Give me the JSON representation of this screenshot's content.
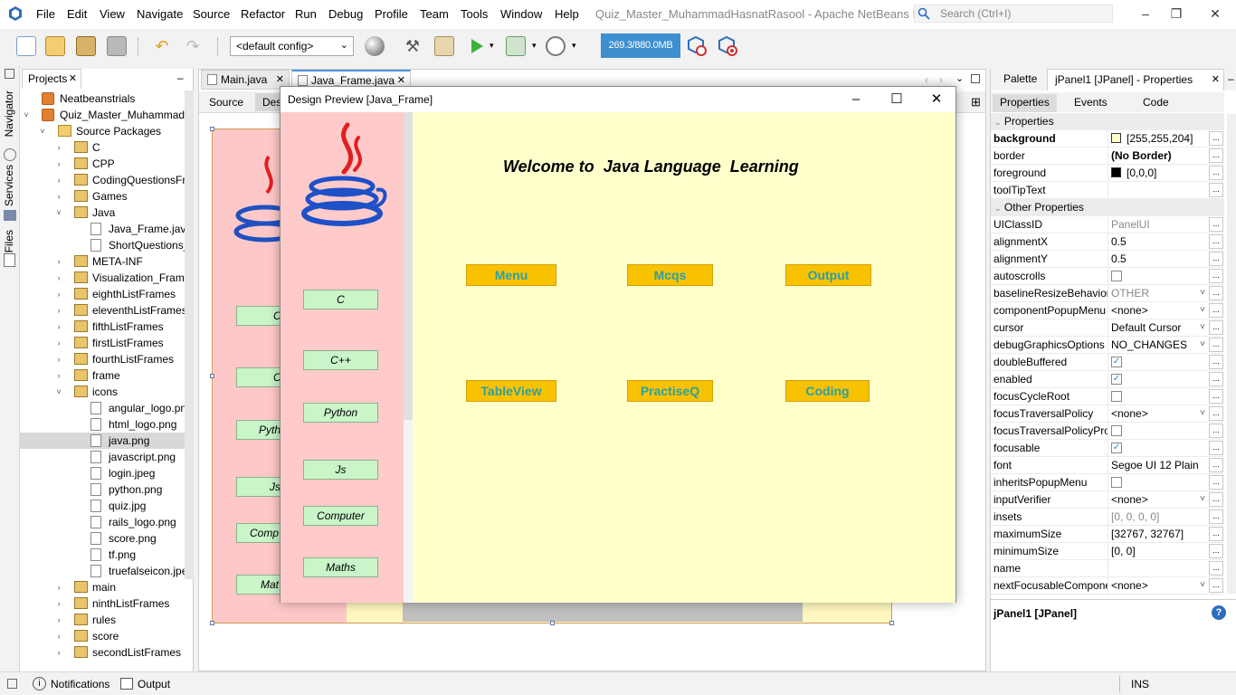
{
  "titlebar": {
    "menu": [
      "File",
      "Edit",
      "View",
      "Navigate",
      "Source",
      "Refactor",
      "Run",
      "Debug",
      "Profile",
      "Team",
      "Tools",
      "Window",
      "Help"
    ],
    "window_title": "Quiz_Master_MuhammadHasnatRasool - Apache NetBeans ID...",
    "search_placeholder": "Search (Ctrl+I)"
  },
  "toolbar": {
    "config": "<default config>",
    "memory": "269.3/880.0MB"
  },
  "left_strip": {
    "tabs": [
      "Navigator",
      "Services",
      "Files"
    ]
  },
  "projects": {
    "tab_label": "Projects",
    "rows": [
      {
        "label": "Neatbeanstrials",
        "depth": 0,
        "kind": "proj",
        "toggle": ""
      },
      {
        "label": "Quiz_Master_MuhammadHas",
        "depth": 0,
        "kind": "proj",
        "toggle": "v"
      },
      {
        "label": "Source Packages",
        "depth": 1,
        "kind": "folder",
        "toggle": "v"
      },
      {
        "label": "C",
        "depth": 2,
        "kind": "pkg",
        "toggle": ">"
      },
      {
        "label": "CPP",
        "depth": 2,
        "kind": "pkg",
        "toggle": ">"
      },
      {
        "label": "CodingQuestionsFrame",
        "depth": 2,
        "kind": "pkg",
        "toggle": ">"
      },
      {
        "label": "Games",
        "depth": 2,
        "kind": "pkg",
        "toggle": ">"
      },
      {
        "label": "Java",
        "depth": 2,
        "kind": "pkg",
        "toggle": "v"
      },
      {
        "label": "Java_Frame.java",
        "depth": 3,
        "kind": "file",
        "toggle": ""
      },
      {
        "label": "ShortQuestions_Fra",
        "depth": 3,
        "kind": "file",
        "toggle": ""
      },
      {
        "label": "META-INF",
        "depth": 2,
        "kind": "pkg",
        "toggle": ">"
      },
      {
        "label": "Visualization_Frames",
        "depth": 2,
        "kind": "pkg",
        "toggle": ">"
      },
      {
        "label": "eighthListFrames",
        "depth": 2,
        "kind": "pkg",
        "toggle": ">"
      },
      {
        "label": "eleventhListFrames",
        "depth": 2,
        "kind": "pkg",
        "toggle": ">"
      },
      {
        "label": "fifthListFrames",
        "depth": 2,
        "kind": "pkg",
        "toggle": ">"
      },
      {
        "label": "firstListFrames",
        "depth": 2,
        "kind": "pkg",
        "toggle": ">"
      },
      {
        "label": "fourthListFrames",
        "depth": 2,
        "kind": "pkg",
        "toggle": ">"
      },
      {
        "label": "frame",
        "depth": 2,
        "kind": "pkg",
        "toggle": ">"
      },
      {
        "label": "icons",
        "depth": 2,
        "kind": "pkg",
        "toggle": "v"
      },
      {
        "label": "angular_logo.png",
        "depth": 3,
        "kind": "file",
        "toggle": ""
      },
      {
        "label": "html_logo.png",
        "depth": 3,
        "kind": "file",
        "toggle": ""
      },
      {
        "label": "java.png",
        "depth": 3,
        "kind": "file",
        "toggle": "",
        "selected": true
      },
      {
        "label": "javascript.png",
        "depth": 3,
        "kind": "file",
        "toggle": ""
      },
      {
        "label": "login.jpeg",
        "depth": 3,
        "kind": "file",
        "toggle": ""
      },
      {
        "label": "python.png",
        "depth": 3,
        "kind": "file",
        "toggle": ""
      },
      {
        "label": "quiz.jpg",
        "depth": 3,
        "kind": "file",
        "toggle": ""
      },
      {
        "label": "rails_logo.png",
        "depth": 3,
        "kind": "file",
        "toggle": ""
      },
      {
        "label": "score.png",
        "depth": 3,
        "kind": "file",
        "toggle": ""
      },
      {
        "label": "tf.png",
        "depth": 3,
        "kind": "file",
        "toggle": ""
      },
      {
        "label": "truefalseicon.jpeg",
        "depth": 3,
        "kind": "file",
        "toggle": ""
      },
      {
        "label": "main",
        "depth": 2,
        "kind": "pkg",
        "toggle": ">"
      },
      {
        "label": "ninthListFrames",
        "depth": 2,
        "kind": "pkg",
        "toggle": ">"
      },
      {
        "label": "rules",
        "depth": 2,
        "kind": "pkg",
        "toggle": ">"
      },
      {
        "label": "score",
        "depth": 2,
        "kind": "pkg",
        "toggle": ">"
      },
      {
        "label": "secondListFrames",
        "depth": 2,
        "kind": "pkg",
        "toggle": ">"
      }
    ]
  },
  "editor": {
    "tabs": [
      "Main.java",
      "Java_Frame.java"
    ],
    "sub_tabs": [
      "Source",
      "Des"
    ],
    "canvas_buttons": [
      "C",
      "C+",
      "Pyth",
      "Js",
      "Comp",
      "Mat"
    ]
  },
  "preview": {
    "title": "Design Preview [Java_Frame]",
    "welcome": "Welcome to  Java Language  Learning",
    "left_buttons": [
      "C",
      "C++",
      "Python",
      "Js",
      "Computer",
      "Maths"
    ],
    "action_buttons": [
      "Menu",
      "Mcqs",
      "Output",
      "TableView",
      "PractiseQ",
      "Coding"
    ],
    "colors": {
      "left_panel": "#ffcaca",
      "main_panel": "#ffffcc",
      "button": "#f8c200",
      "button_text": "#2ba0a8"
    }
  },
  "properties": {
    "palette_tab": "Palette",
    "props_tab": "jPanel1 [JPanel] - Properties",
    "sub_tabs": [
      "Properties",
      "Events",
      "Code"
    ],
    "section_main": "Properties",
    "main_rows": [
      {
        "name": "background",
        "value": "[255,255,204]",
        "bold": true,
        "swatch": "#ffffcc"
      },
      {
        "name": "border",
        "value": "(No Border)",
        "bold": false,
        "value_bold": true
      },
      {
        "name": "foreground",
        "value": "[0,0,0]",
        "swatch": "#000000"
      },
      {
        "name": "toolTipText",
        "value": ""
      }
    ],
    "section_other": "Other Properties",
    "other_rows": [
      {
        "name": "UIClassID",
        "value": "PanelUI",
        "dim": true
      },
      {
        "name": "alignmentX",
        "value": "0.5"
      },
      {
        "name": "alignmentY",
        "value": "0.5"
      },
      {
        "name": "autoscrolls",
        "check": "off"
      },
      {
        "name": "baselineResizeBehavior",
        "value": "OTHER",
        "dim": true,
        "chevron": true
      },
      {
        "name": "componentPopupMenu",
        "value": "<none>",
        "chevron": true
      },
      {
        "name": "cursor",
        "value": "Default Cursor",
        "chevron": true
      },
      {
        "name": "debugGraphicsOptions",
        "value": "NO_CHANGES",
        "chevron": true
      },
      {
        "name": "doubleBuffered",
        "check": "on"
      },
      {
        "name": "enabled",
        "check": "on"
      },
      {
        "name": "focusCycleRoot",
        "check": "off"
      },
      {
        "name": "focusTraversalPolicy",
        "value": "<none>",
        "chevron": true
      },
      {
        "name": "focusTraversalPolicyPro",
        "check": "off"
      },
      {
        "name": "focusable",
        "check": "on"
      },
      {
        "name": "font",
        "value": "Segoe UI 12 Plain"
      },
      {
        "name": "inheritsPopupMenu",
        "check": "off"
      },
      {
        "name": "inputVerifier",
        "value": "<none>",
        "chevron": true
      },
      {
        "name": "insets",
        "value": "[0, 0, 0, 0]",
        "dim": true
      },
      {
        "name": "maximumSize",
        "value": "[32767, 32767]"
      },
      {
        "name": "minimumSize",
        "value": "[0, 0]"
      },
      {
        "name": "name",
        "value": ""
      },
      {
        "name": "nextFocusableCompone",
        "value": "<none>",
        "chevron": true
      }
    ],
    "footer_title": "jPanel1 [JPanel]"
  },
  "statusbar": {
    "notifications": "Notifications",
    "output": "Output",
    "mode": "INS"
  }
}
